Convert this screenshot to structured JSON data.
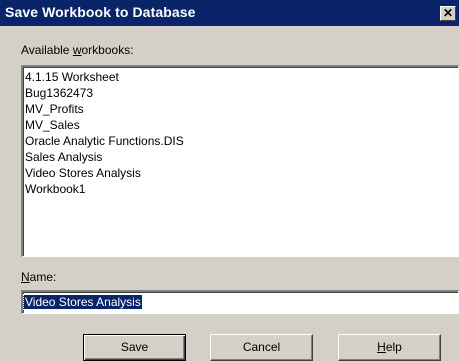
{
  "window": {
    "title": "Save Workbook to Database",
    "close_glyph": "✕"
  },
  "available": {
    "label_pre": "Available ",
    "label_hot": "w",
    "label_post": "orkbooks:",
    "items": [
      "4.1.15 Worksheet",
      "Bug1362473",
      "MV_Profits",
      "MV_Sales",
      "Oracle Analytic Functions.DIS",
      "Sales Analysis",
      "Video Stores Analysis",
      "Workbook1"
    ]
  },
  "name": {
    "label_hot": "N",
    "label_post": "ame:",
    "value": "Video Stores Analysis"
  },
  "buttons": {
    "save": "Save",
    "cancel": "Cancel",
    "help_hot": "H",
    "help_post": "elp"
  },
  "colors": {
    "titlebar": "#0a246a",
    "face": "#d4d0c8"
  }
}
